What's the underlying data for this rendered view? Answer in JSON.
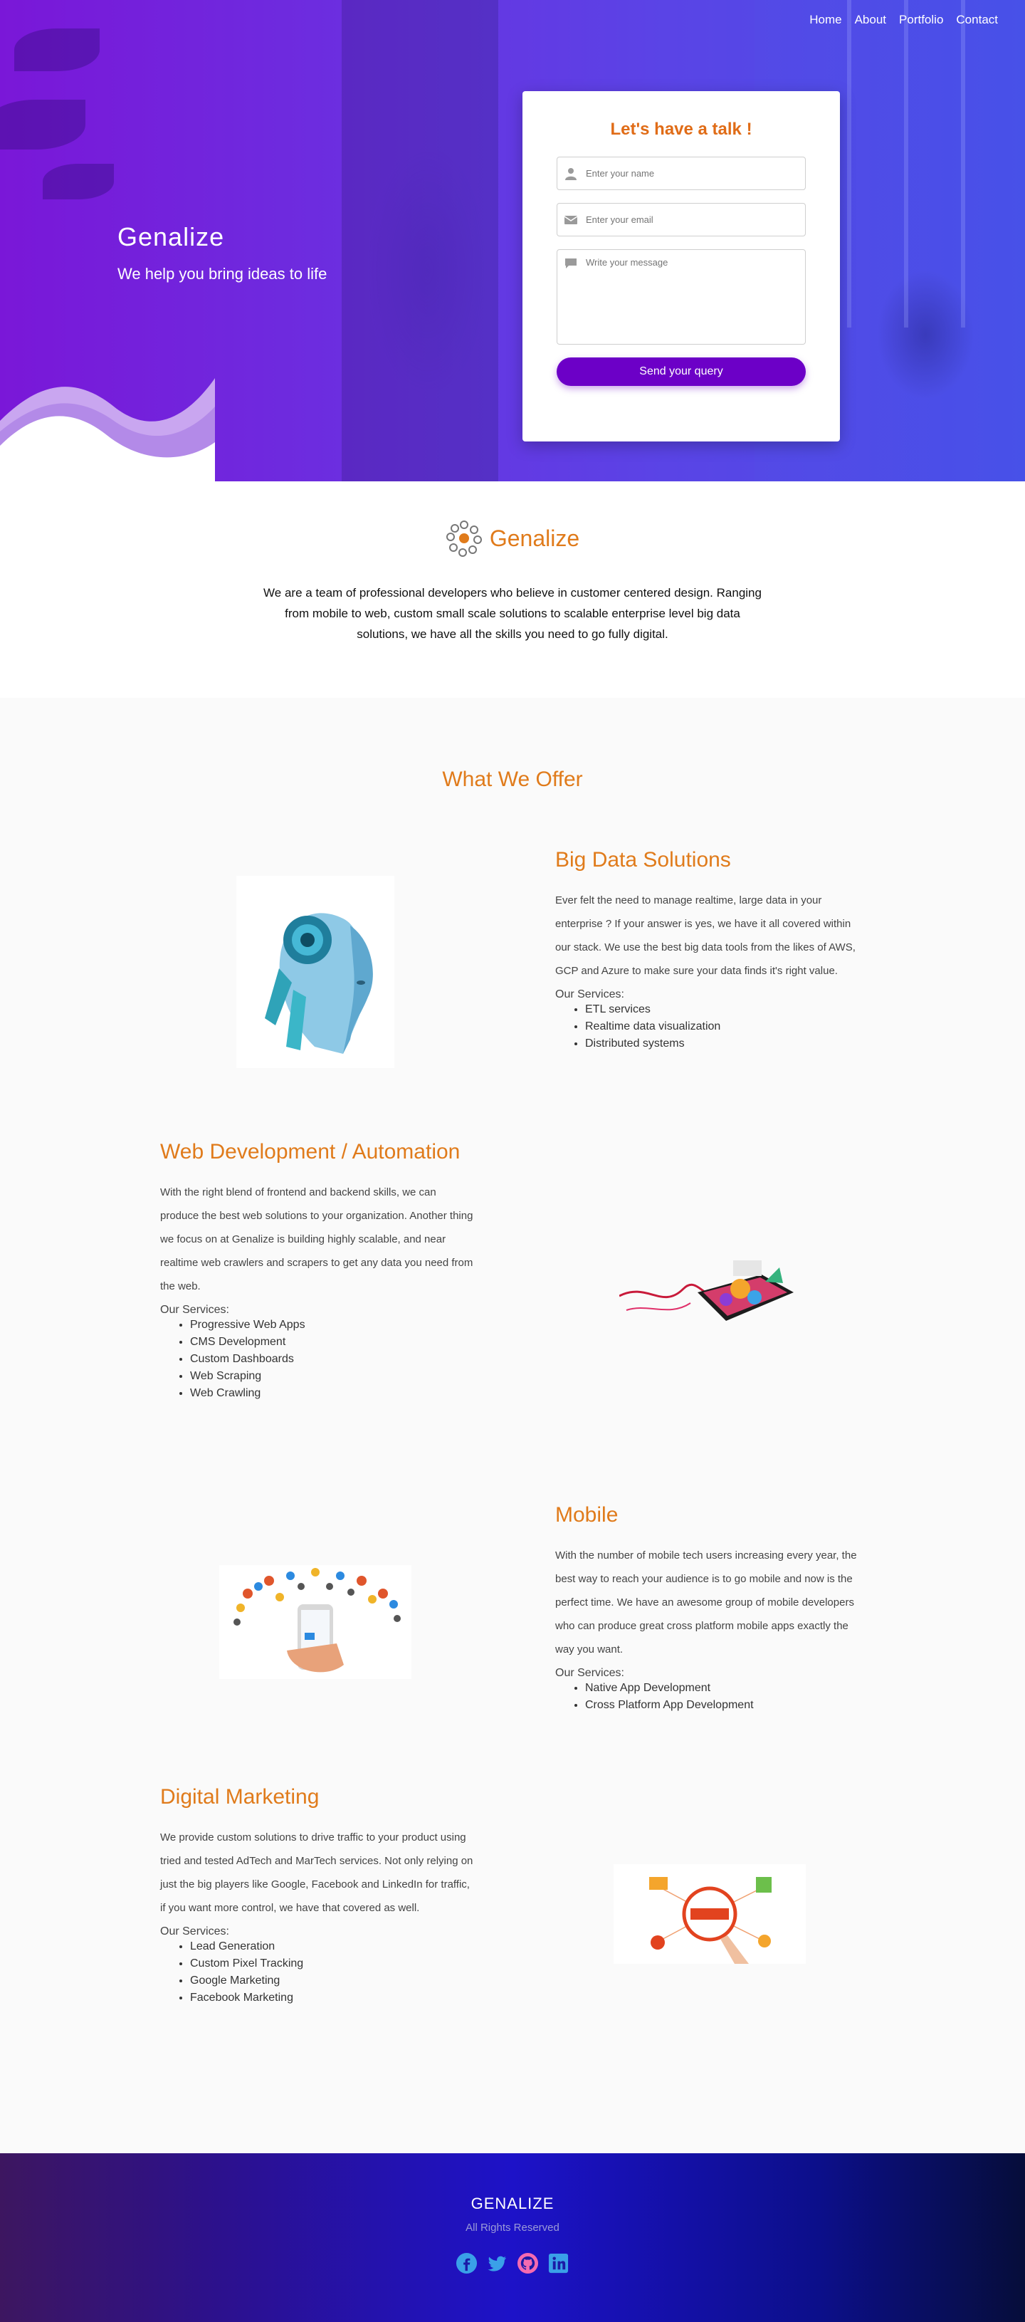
{
  "nav": {
    "items": [
      "Home",
      "About",
      "Portfolio",
      "Contact"
    ]
  },
  "hero": {
    "title": "Genalize",
    "subtitle": "We help you bring ideas to life"
  },
  "contact": {
    "heading": "Let's have a talk !",
    "name_placeholder": "Enter your name",
    "email_placeholder": "Enter your email",
    "message_placeholder": "Write your message",
    "submit_label": "Send your query"
  },
  "about": {
    "brand": "Genalize",
    "text": "We are a team of professional developers who believe in customer centered design. Ranging from mobile to web, custom small scale solutions to scalable enterprise level big data solutions, we have all the skills you need to go fully digital."
  },
  "offer": {
    "title": "What We Offer",
    "services_label": "Our Services:",
    "items": [
      {
        "title": "Big Data Solutions",
        "description": "Ever felt the need to manage realtime, large data in your enterprise ? If your answer is yes, we have it all covered within our stack. We use the best big data tools from the likes of AWS, GCP and Azure to make sure your data finds it's right value.",
        "services": [
          "ETL services",
          "Realtime data visualization",
          "Distributed systems"
        ],
        "image": "ai-robot-head"
      },
      {
        "title": "Web Development / Automation",
        "description": "With the right blend of frontend and backend skills, we can produce the best web solutions to your organization. Another thing we focus on at Genalize is building highly scalable, and near realtime web crawlers and scrapers to get any data you need from the web.",
        "services": [
          "Progressive Web Apps",
          "CMS Development",
          "Custom Dashboards",
          "Web Scraping",
          "Web Crawling"
        ],
        "image": "tablet-splash"
      },
      {
        "title": "Mobile",
        "description": "With the number of mobile tech users increasing every year, the best way to reach your audience is to go mobile and now is the perfect time. We have an awesome group of mobile developers who can produce great cross platform mobile apps exactly the way you want.",
        "services": [
          "Native App Development",
          "Cross Platform App Development"
        ],
        "image": "phone-app-icons"
      },
      {
        "title": "Digital Marketing",
        "description": "We provide custom solutions to drive traffic to your product using tried and tested AdTech and MarTech services. Not only relying on just the big players like Google, Facebook and LinkedIn for traffic, if you want more control, we have that covered as well.",
        "services": [
          "Lead Generation",
          "Custom Pixel Tracking",
          "Google Marketing",
          "Facebook Marketing"
        ],
        "image": "digital-marketing-badge"
      }
    ]
  },
  "footer": {
    "title": "GENALIZE",
    "subtitle": "All Rights Reserved",
    "socials": [
      "facebook-icon",
      "twitter-icon",
      "github-icon",
      "linkedin-icon"
    ]
  },
  "colors": {
    "accent": "#e07b1b",
    "button": "#6c00c7",
    "hero_start": "#7a17d8",
    "hero_end": "#4650e8",
    "social": "#3aa0e8"
  }
}
